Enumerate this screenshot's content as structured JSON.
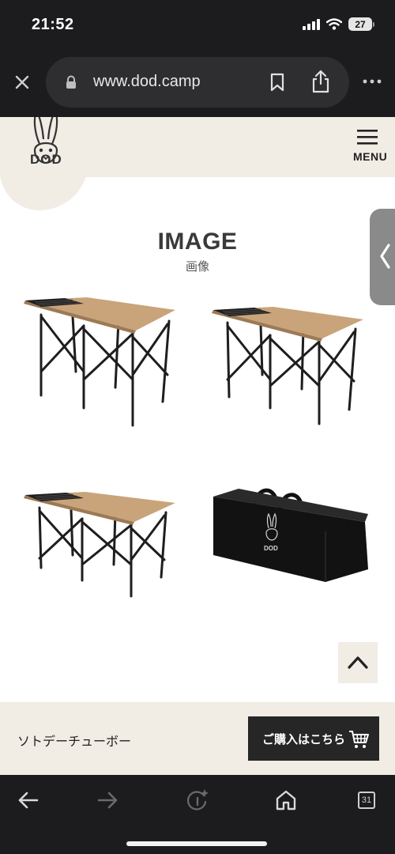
{
  "status_bar": {
    "time": "21:52",
    "battery": "27"
  },
  "browser": {
    "url": "www.dod.camp"
  },
  "site": {
    "logo_text": "DOD",
    "menu_label": "MENU",
    "section_title": "IMAGE",
    "section_subtitle": "画像"
  },
  "gallery": {
    "images": [
      {
        "name": "table-photo-1"
      },
      {
        "name": "table-photo-2"
      },
      {
        "name": "table-photo-3"
      },
      {
        "name": "carry-bag-photo"
      }
    ]
  },
  "purchase": {
    "product_name": "ソトデーチューボー",
    "buy_label": "ご購入はこちら"
  },
  "toolbar": {
    "tabs_count": "31"
  },
  "colors": {
    "header_bg": "#f1ece4",
    "browser_bg": "#1c1c1e",
    "button_dark": "#262626",
    "wood": "#c9a47a"
  }
}
